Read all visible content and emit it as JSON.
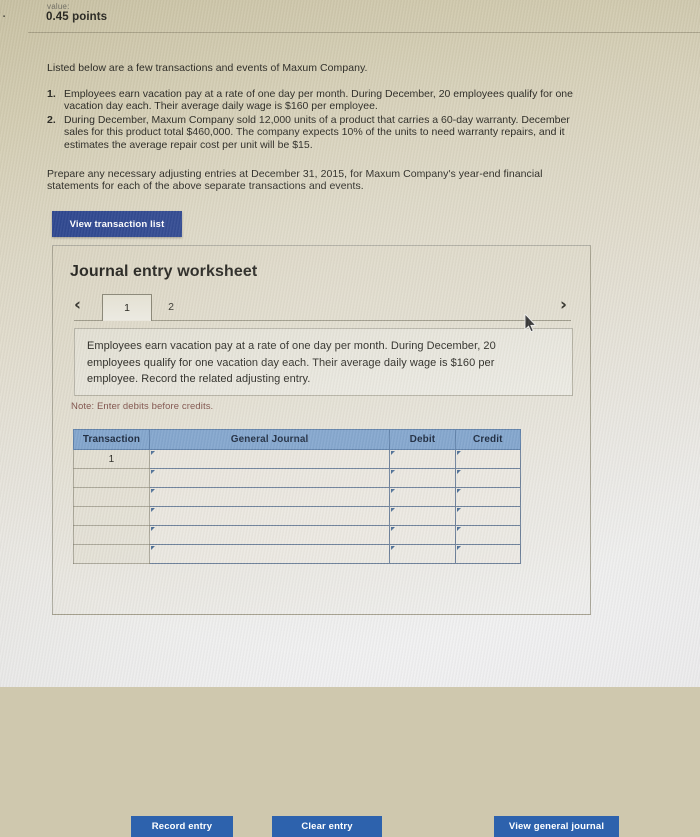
{
  "meta": {
    "corner_glyph": ").",
    "value_label": "value:",
    "value_points": "0.45 points"
  },
  "question": {
    "intro": "Listed below are a few transactions and events of Maxum Company.",
    "items": [
      {
        "number": "1.",
        "text": "Employees earn vacation pay at a rate of one day per month. During December, 20 employees qualify for one vacation day each. Their average daily wage is $160 per employee."
      },
      {
        "number": "2.",
        "text": "During December, Maxum Company sold 12,000 units of a product that carries a 60-day warranty. December sales for this product total $460,000. The company expects 10% of the units to need warranty repairs, and it estimates the average repair cost per unit will be $15."
      }
    ],
    "instruction": "Prepare any necessary adjusting entries at December 31, 2015, for Maxum Company's year-end financial statements for each of the above separate transactions and events.",
    "view_transaction_list_label": "View transaction list"
  },
  "worksheet": {
    "title": "Journal entry worksheet",
    "prev_chevron": "‹",
    "next_chevron": "›",
    "tabs": [
      {
        "label": "1",
        "active": true
      },
      {
        "label": "2",
        "active": false
      }
    ],
    "prompt": "Employees earn vacation pay at a rate of one day per month. During December, 20 employees qualify for one vacation day each. Their average daily wage is $160 per employee. Record the related adjusting entry.",
    "note": "Note: Enter debits before credits.",
    "table": {
      "headers": [
        "Transaction",
        "General Journal",
        "Debit",
        "Credit"
      ],
      "rows": [
        {
          "transaction": "1",
          "general_journal": "",
          "debit": "",
          "credit": ""
        },
        {
          "transaction": "",
          "general_journal": "",
          "debit": "",
          "credit": ""
        },
        {
          "transaction": "",
          "general_journal": "",
          "debit": "",
          "credit": ""
        },
        {
          "transaction": "",
          "general_journal": "",
          "debit": "",
          "credit": ""
        },
        {
          "transaction": "",
          "general_journal": "",
          "debit": "",
          "credit": ""
        },
        {
          "transaction": "",
          "general_journal": "",
          "debit": "",
          "credit": ""
        }
      ]
    },
    "buttons": {
      "record_entry": "Record entry",
      "clear_entry": "Clear entry",
      "view_general_journal": "View general journal"
    }
  },
  "colors": {
    "primary_button": "#2d62ad",
    "dark_button": "#27418c",
    "table_header": "#7fa3cc",
    "note_text": "#7c4d45"
  }
}
